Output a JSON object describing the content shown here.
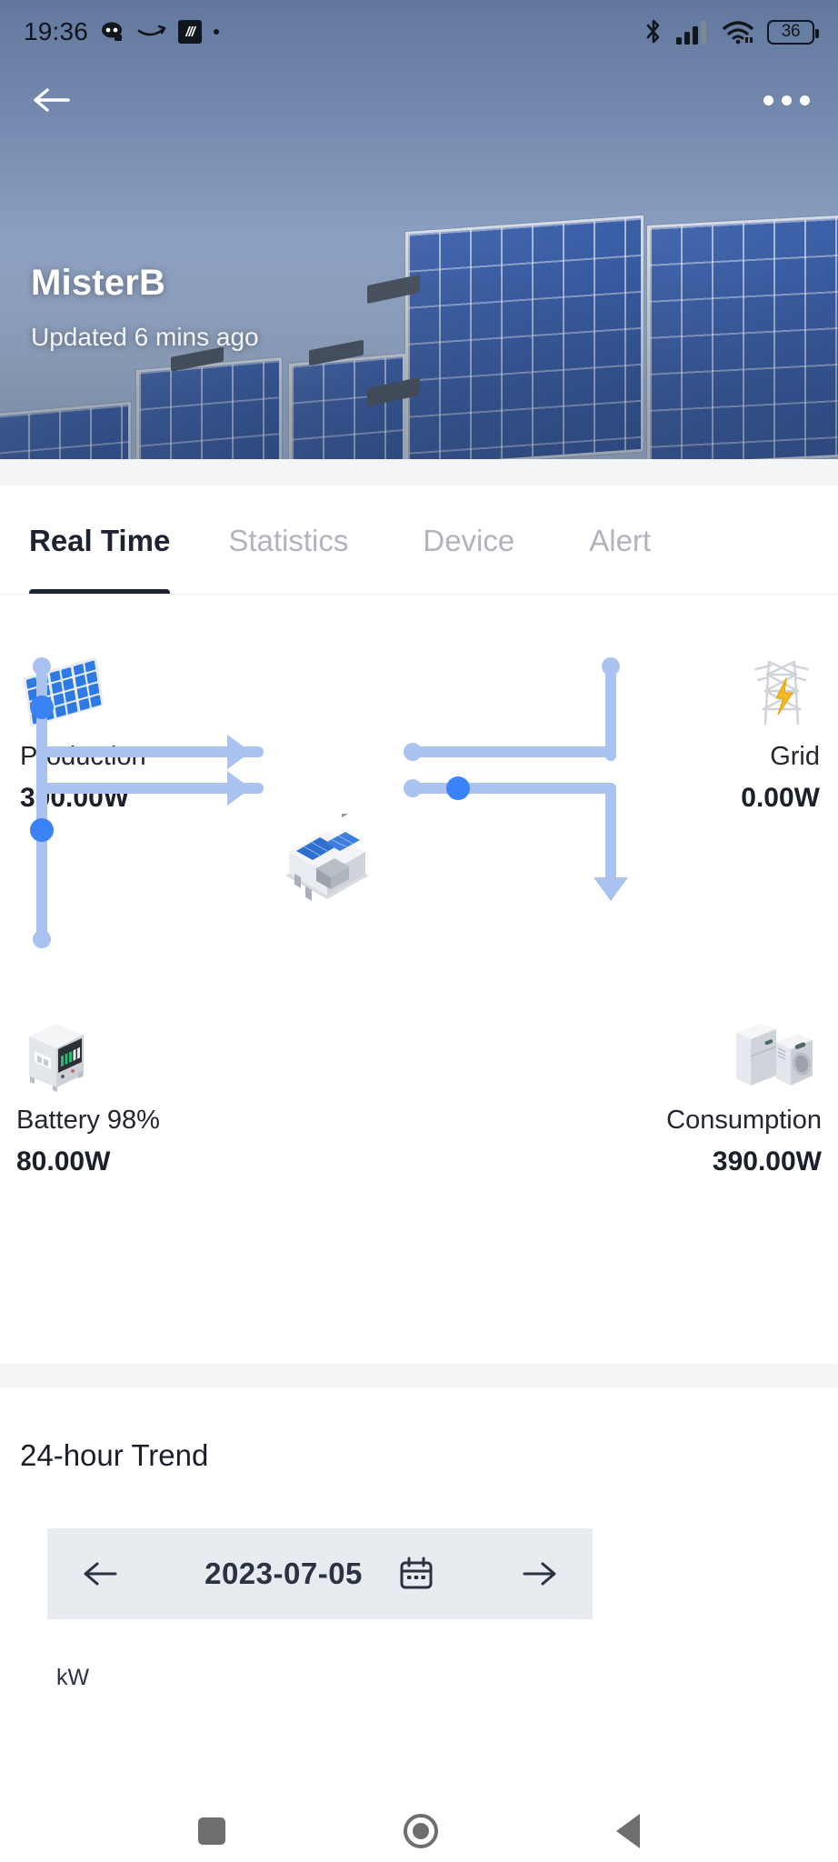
{
  "statusbar": {
    "time": "19:36",
    "icons": [
      "discord-icon",
      "amazon-icon",
      "app-icon",
      "dot-icon"
    ],
    "bluetooth": "bluetooth-icon",
    "signal": "cellular-signal-icon",
    "wifi": "wifi-icon",
    "battery_percent": "36"
  },
  "appbar": {
    "back": "back-arrow-icon",
    "menu": "overflow-menu-icon"
  },
  "hero": {
    "site_name": "MisterB",
    "updated": "Updated 6 mins ago"
  },
  "tabs": [
    {
      "label": "Real Time",
      "active": true
    },
    {
      "label": "Statistics",
      "active": false
    },
    {
      "label": "Device",
      "active": false
    },
    {
      "label": "Alert",
      "active": false
    }
  ],
  "flow": {
    "production": {
      "label": "Production",
      "value": "300.00W",
      "icon": "solar-panel-icon"
    },
    "grid": {
      "label": "Grid",
      "value": "0.00W",
      "icon": "power-tower-icon"
    },
    "battery": {
      "label": "Battery  98%",
      "value": "80.00W",
      "icon": "battery-cabinet-icon"
    },
    "consumption": {
      "label": "Consumption",
      "value": "390.00W",
      "icon": "appliances-icon"
    },
    "house_icon": "house-icon",
    "line_color": "#a9c2ef",
    "dot_color": "#3b82f6"
  },
  "trend": {
    "title": "24-hour Trend",
    "prev": "left-arrow-icon",
    "next": "right-arrow-icon",
    "date": "2023-07-05",
    "calendar": "calendar-icon",
    "unit": "kW"
  },
  "navbar": {
    "recents": "recents-square-icon",
    "home": "home-circle-icon",
    "back": "back-triangle-icon"
  }
}
